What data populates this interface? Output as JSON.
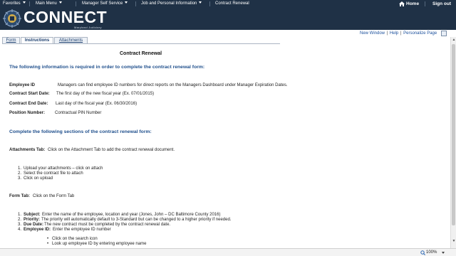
{
  "topnav": {
    "favorites": "Favorites",
    "main_menu": "Main Menu",
    "breadcrumb": [
      "Manager Self Service",
      "Job and Personal Information",
      "Contract Renewal"
    ],
    "home": "Home",
    "sign_out": "Sign out"
  },
  "banner": {
    "logo": "CONNECT",
    "sub": "Maryland Judiciary"
  },
  "pagebar": {
    "new_window": "New Window",
    "help": "Help",
    "personalize": "Personalize Page"
  },
  "tabs": [
    "Form",
    "Instructions",
    "Attachments"
  ],
  "content": {
    "title": "Contract Renewal",
    "heading1": "The following information is required in order to complete the contract renewal form:",
    "fields": [
      {
        "label": "Employee ID",
        "text": "Managers can find employee ID numbers for direct reports on the Managers Dashboard under Manager Expiration Dates."
      },
      {
        "label": "Contract Start Date:",
        "text": "The first day of the new fiscal year (Ex. 07/01/2015)"
      },
      {
        "label": "Contract End Date:",
        "text": "Last day of the fiscal year (Ex. 06/30/2016)"
      },
      {
        "label": "Position Number:",
        "text": "Contractual PIN Number"
      }
    ],
    "heading2": "Complete the following sections of the contract renewal form:",
    "attachments_label": "Attachments Tab:",
    "attachments_text": "Click on the Attachment Tab to add the contract renewal document.",
    "attach_steps": [
      "Upload your attachments – click on attach",
      "Select the contract file to attach",
      "Click on upload"
    ],
    "form_label": "Form Tab:",
    "form_text": "Click on the Form Tab",
    "form_steps": [
      {
        "label": "Subject:",
        "text": "Enter the name of the employee, location and year (Jones, John – DC Baltimore County 2016)"
      },
      {
        "label": "Priority:",
        "text": "The priority will automatically default to 3-Standard but can be changed to a higher priority if needed."
      },
      {
        "label": "Due Date:",
        "text": "The new contract must be completed by the contract renewal date."
      },
      {
        "label": "Employee ID:",
        "text": "Enter the employee ID number"
      }
    ],
    "sub_steps": [
      "Click on the search icon",
      "Look up employee ID by entering employee name"
    ]
  },
  "status": {
    "zoom": "100%"
  }
}
